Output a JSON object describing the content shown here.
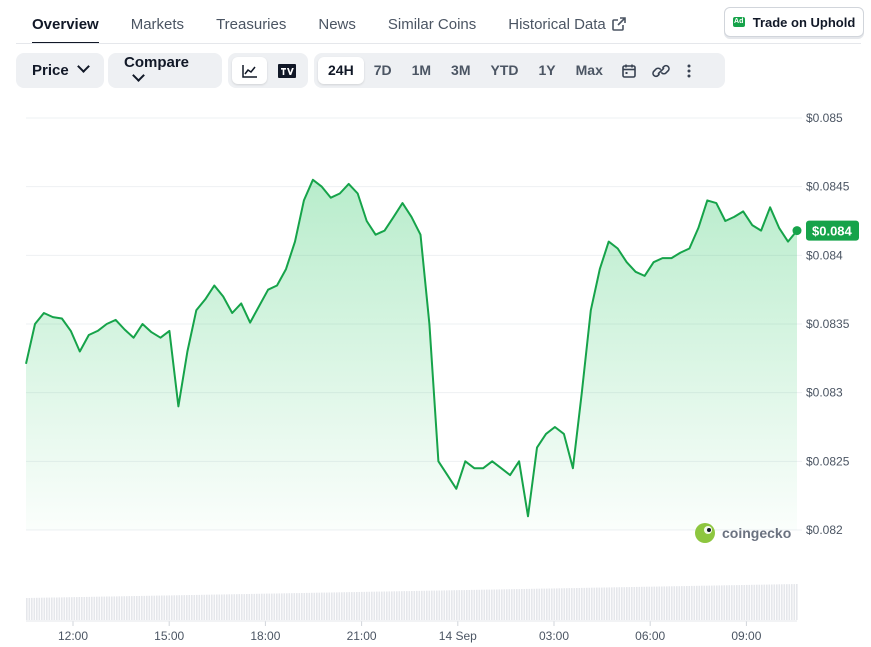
{
  "tabs": [
    {
      "label": "Overview",
      "active": true
    },
    {
      "label": "Markets"
    },
    {
      "label": "Treasuries"
    },
    {
      "label": "News"
    },
    {
      "label": "Similar Coins"
    },
    {
      "label": "Historical Data",
      "external": true
    }
  ],
  "sponsor": {
    "badge": "Ad",
    "label": "Trade on Uphold"
  },
  "toolbar": {
    "price_label": "Price",
    "compare_label": "Compare",
    "chart_modes": [
      "line-chart-icon",
      "tradingview-icon"
    ],
    "ranges": [
      "24H",
      "7D",
      "1M",
      "3M",
      "YTD",
      "1Y",
      "Max"
    ],
    "selected_range": "24H",
    "icons": [
      "calendar-icon",
      "link-icon",
      "more-icon"
    ]
  },
  "watermark": "coingecko",
  "colors": {
    "line": "#16a34a",
    "fill": "#22c55e",
    "badge": "#16a34a"
  },
  "chart_data": {
    "type": "area",
    "title": "",
    "xlabel": "",
    "ylabel": "",
    "y_ticks": [
      "$0.085",
      "$0.0845",
      "$0.084",
      "$0.0835",
      "$0.083",
      "$0.0825",
      "$0.082"
    ],
    "ylim": [
      0.082,
      0.085
    ],
    "x_ticks": [
      "12:00",
      "15:00",
      "18:00",
      "21:00",
      "14 Sep",
      "03:00",
      "06:00",
      "09:00"
    ],
    "current_price_label": "$0.084",
    "grid": true,
    "series": [
      {
        "values": [
          0.08321,
          0.0835,
          0.08358,
          0.08355,
          0.08354,
          0.08345,
          0.0833,
          0.08342,
          0.08345,
          0.0835,
          0.08353,
          0.08346,
          0.0834,
          0.0835,
          0.08344,
          0.0834,
          0.08345,
          0.0829,
          0.0833,
          0.0836,
          0.08368,
          0.08378,
          0.0837,
          0.08358,
          0.08365,
          0.08351,
          0.08363,
          0.08375,
          0.08378,
          0.0839,
          0.0841,
          0.0844,
          0.08455,
          0.0845,
          0.08442,
          0.08445,
          0.08452,
          0.08445,
          0.08425,
          0.08415,
          0.08418,
          0.08428,
          0.08438,
          0.08428,
          0.08415,
          0.0835,
          0.0825,
          0.0824,
          0.0823,
          0.0825,
          0.08245,
          0.08245,
          0.0825,
          0.08245,
          0.0824,
          0.0825,
          0.0821,
          0.0826,
          0.0827,
          0.08275,
          0.0827,
          0.08245,
          0.083,
          0.0836,
          0.0839,
          0.0841,
          0.08405,
          0.08395,
          0.08388,
          0.08385,
          0.08395,
          0.08398,
          0.08398,
          0.08402,
          0.08405,
          0.0842,
          0.0844,
          0.08438,
          0.08425,
          0.08428,
          0.08432,
          0.08422,
          0.08418,
          0.08435,
          0.0842,
          0.0841,
          0.08418
        ]
      }
    ]
  }
}
